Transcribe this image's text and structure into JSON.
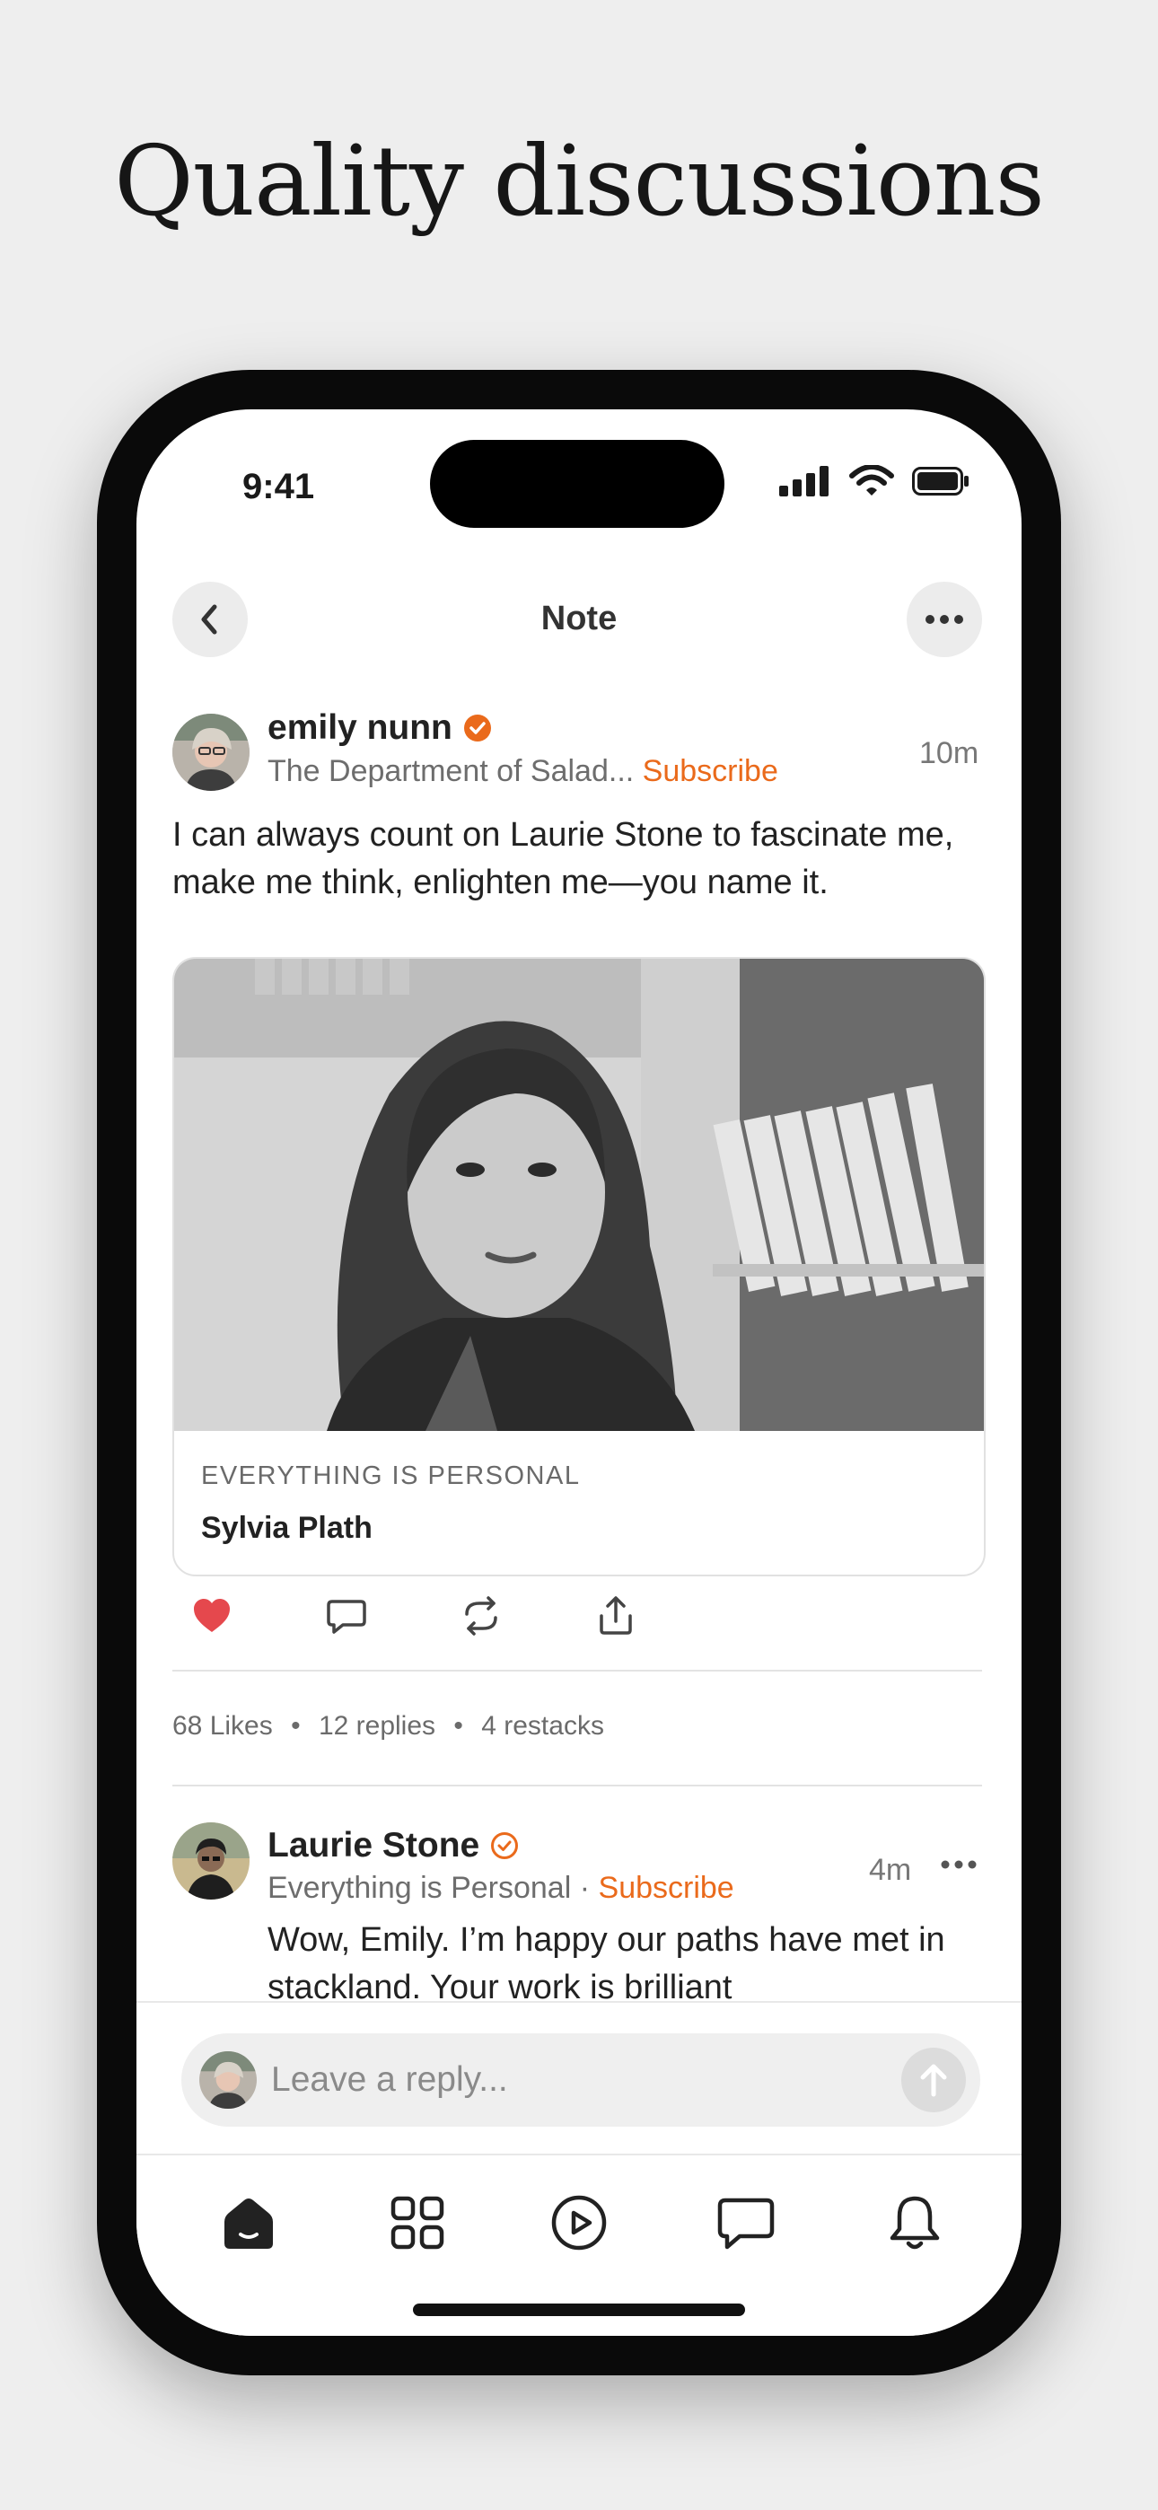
{
  "headline": "Quality discussions",
  "status_bar": {
    "time": "9:41"
  },
  "nav": {
    "title": "Note"
  },
  "note": {
    "author": "emily nunn",
    "publication": "The Department of Salad...",
    "subscribe": "Subscribe",
    "time_ago": "10m",
    "text": "I can always count on Laurie Stone to fascinate me, make me think, enlighten me—you name it."
  },
  "card": {
    "kicker": "EVERYTHING IS PERSONAL",
    "title": "Sylvia Plath"
  },
  "stats": {
    "likes": "68 Likes",
    "replies": "12 replies",
    "restacks": "4 restacks",
    "separator": "•"
  },
  "reply": {
    "author": "Laurie Stone",
    "publication": "Everything is Personal",
    "separator": "·",
    "subscribe": "Subscribe",
    "time_ago": "4m",
    "text": "Wow, Emily. I’m happy our paths have met in stackland. Your work is brilliant"
  },
  "composer": {
    "placeholder": "Leave a reply..."
  },
  "tabs": [
    "home-icon",
    "grid-icon",
    "play-icon",
    "chat-icon",
    "bell-icon"
  ],
  "colors": {
    "accent": "#ea6a1b",
    "like": "#e5484d",
    "background": "#eeeeee"
  }
}
